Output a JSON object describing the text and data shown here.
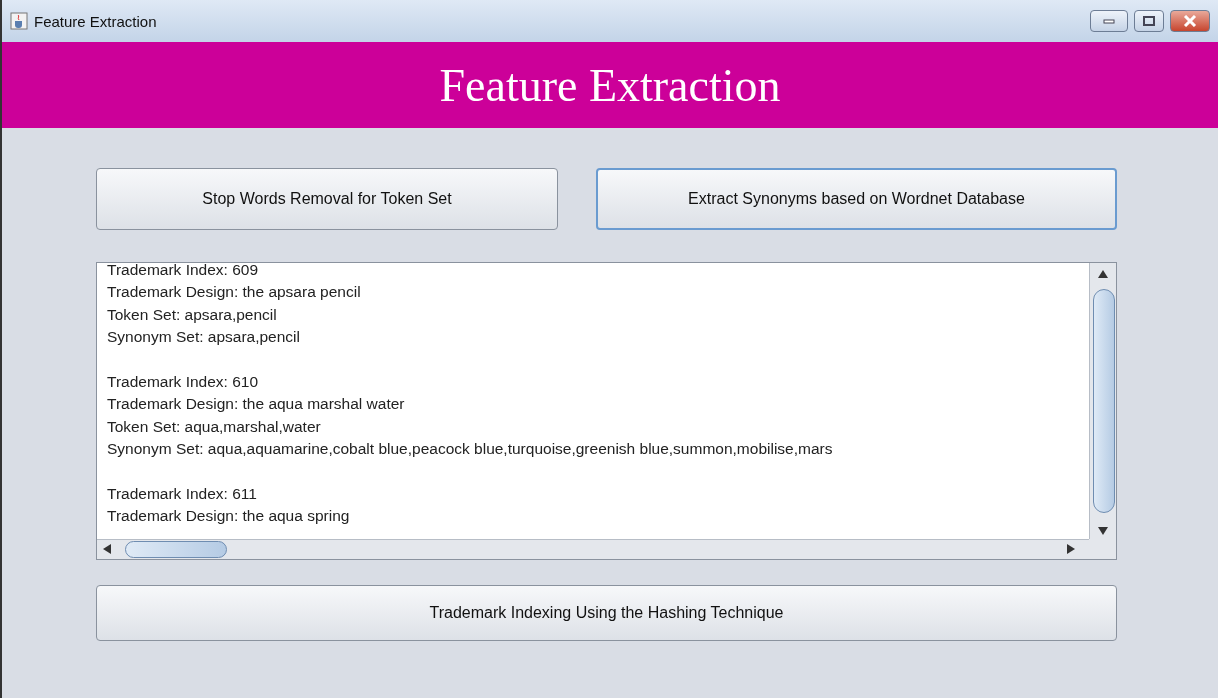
{
  "window": {
    "title": "Feature Extraction"
  },
  "header": {
    "title": "Feature Extraction"
  },
  "top_buttons": [
    {
      "label": "Stop Words Removal for Token Set",
      "focused": false
    },
    {
      "label": "Extract Synonyms based on Wordnet Database",
      "focused": true
    }
  ],
  "output": {
    "records": [
      {
        "lines": [
          "Trademark Index: 609",
          "Trademark Design: the apsara pencil",
          "Token Set: apsara,pencil",
          "Synonym Set: apsara,pencil"
        ]
      },
      {
        "lines": [
          "Trademark Index: 610",
          "Trademark Design: the aqua marshal water",
          "Token Set: aqua,marshal,water",
          "Synonym Set: aqua,aquamarine,cobalt blue,peacock blue,turquoise,greenish blue,summon,mobilise,mars"
        ]
      },
      {
        "lines": [
          "Trademark Index: 611",
          "Trademark Design: the aqua spring"
        ]
      }
    ]
  },
  "bottom_button": {
    "label": "Trademark Indexing Using the Hashing Technique",
    "focused": false
  }
}
